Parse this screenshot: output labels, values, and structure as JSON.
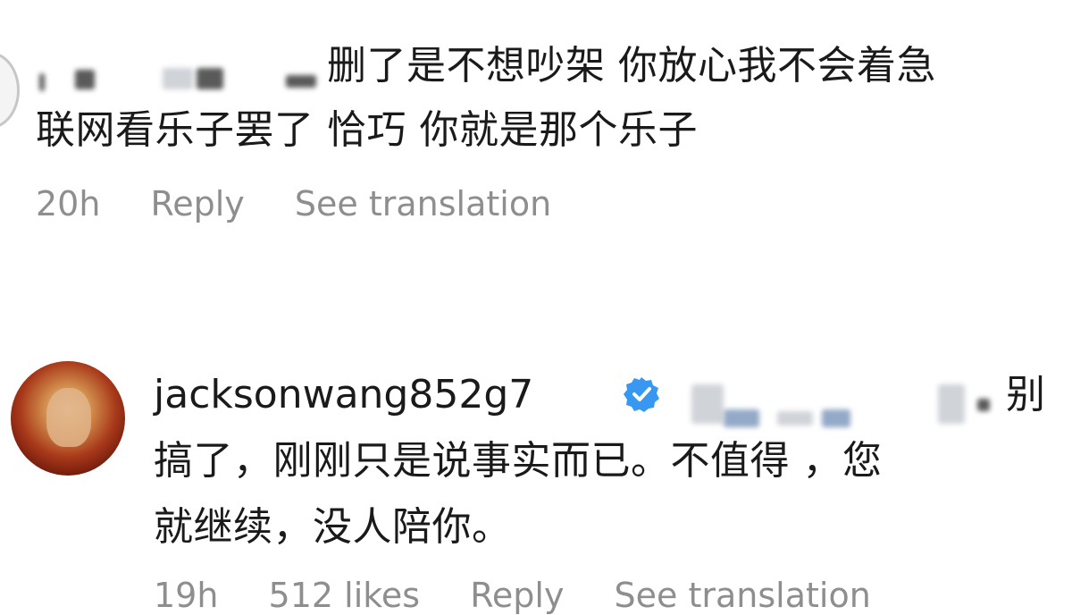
{
  "comment1": {
    "line1_text": "删了是不想吵架 你放心我不会着急",
    "line2_text": "联网看乐子罢了 恰巧 你就是那个乐子",
    "time": "20h",
    "reply_label": "Reply",
    "translate_label": "See translation"
  },
  "comment2": {
    "username": "jacksonwang852g7",
    "verified_icon": "verified-badge-icon",
    "line1_tail": "别",
    "line2_text": "搞了，刚刚只是说事实而已。不值得 ，您",
    "line3_text": "就继续，没人陪你。",
    "time": "19h",
    "likes": "512 likes",
    "reply_label": "Reply",
    "translate_label": "See translation"
  },
  "colors": {
    "meta_text": "#8e8e8e",
    "verified_blue": "#3897f0"
  }
}
